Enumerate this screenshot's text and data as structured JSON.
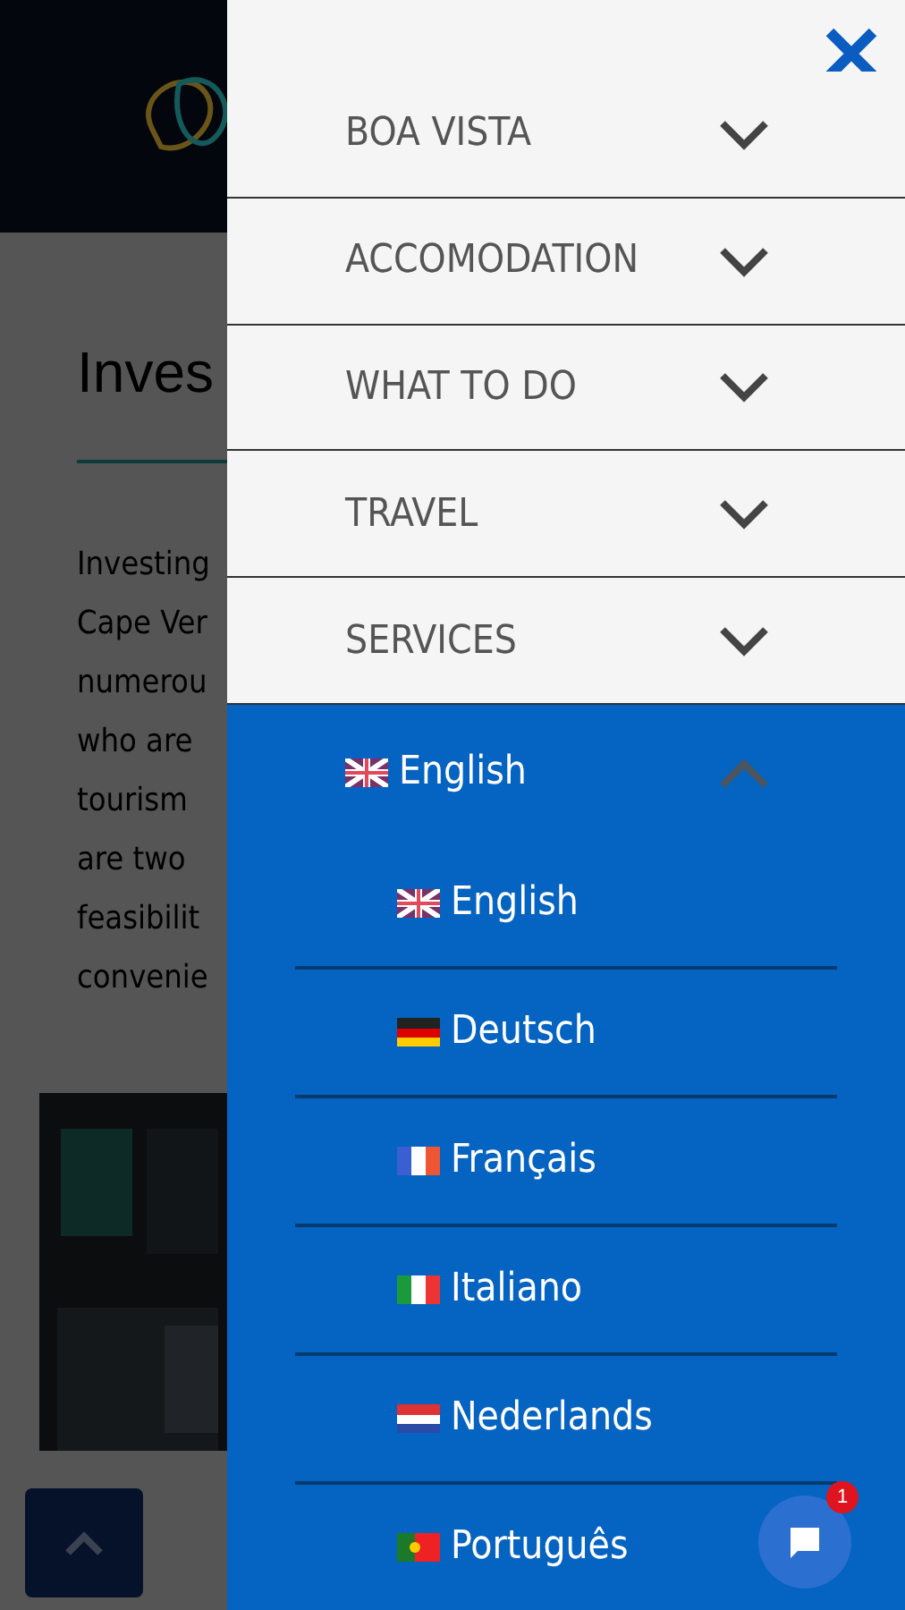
{
  "page": {
    "title": "Inves",
    "paragraph_lines": [
      "Investing",
      "Cape Ver",
      "numerou",
      "who are",
      "tourism",
      "are two",
      "feasibilit",
      "convenie"
    ]
  },
  "menu": {
    "items": [
      {
        "label": "BOA VISTA",
        "expanded": false
      },
      {
        "label": "ACCOMODATION",
        "expanded": false
      },
      {
        "label": "WHAT TO DO",
        "expanded": false
      },
      {
        "label": "TRAVEL",
        "expanded": false
      },
      {
        "label": "SERVICES",
        "expanded": false
      }
    ],
    "language": {
      "label": "English",
      "kind": "gb",
      "expanded": true,
      "options": [
        {
          "label": "English",
          "kind": "gb"
        },
        {
          "label": "Deutsch",
          "kind": "de"
        },
        {
          "label": "Français",
          "kind": "fr"
        },
        {
          "label": "Italiano",
          "kind": "it"
        },
        {
          "label": "Nederlands",
          "kind": "nl"
        },
        {
          "label": "Português",
          "kind": "pt"
        }
      ]
    }
  },
  "chat": {
    "badge": "1"
  }
}
